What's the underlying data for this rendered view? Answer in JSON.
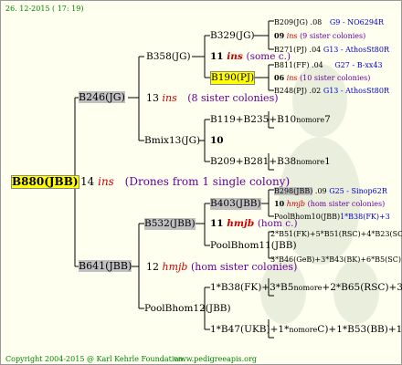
{
  "header": {
    "date": "26. 12-2015 ( 17: 19)"
  },
  "footer": {
    "copyright": "Copyright 2004-2015 @ Karl Kehrle Foundation.",
    "site": "www.pedigreeapis.org"
  },
  "root": {
    "id": "B880(JBB)",
    "gen": "14",
    "tag": "ins",
    "note": "(Drones from 1 single colony)"
  },
  "b246": {
    "id": "B246(JG)",
    "gen": "13",
    "tag": "ins",
    "note": "(8 sister colonies)"
  },
  "b641": {
    "id": "B641(JBB)",
    "gen": "12",
    "tag": "hmjb",
    "note": "(hom sister colonies)"
  },
  "b358": {
    "id": "B358(JG)",
    "gen": "11",
    "tag": "ins",
    "note": "(some c.)"
  },
  "bmix": {
    "id": "Bmix13(JG)",
    "gen": "10"
  },
  "b532": {
    "id": "B532(JBB)",
    "gen": "11",
    "tag": "hmjb",
    "note": "(hom c.)"
  },
  "pool12": {
    "id": "PoolBhom12(JBB)",
    "gen": "10"
  },
  "b329": {
    "id": "B329(JG)",
    "gen": "09",
    "tag": "ins",
    "note": "(some c.)"
  },
  "b190": {
    "id": "B190(PJ)"
  },
  "b119": {
    "id": "B119+B235+B10",
    "suffix": "nomore",
    "gen": "7"
  },
  "b209": {
    "id": "B209+B281+B38",
    "suffix": "nomore",
    "gen": "1"
  },
  "b403": {
    "id": "B403(JBB)",
    "gen": "10",
    "tag": "hmjb",
    "note": "(hom sister colonies)"
  },
  "pool11": {
    "id": "PoolBhom11(JBB)",
    "gen": "09"
  },
  "g5": [
    {
      "id": "B209(JG)",
      "gen": ".08",
      "ref": "G9 - NO6294R"
    },
    {
      "id": "09",
      "tag": "ins",
      "note": "(9 sister colonies)"
    },
    {
      "id": "B271(PJ)",
      "gen": ".04",
      "ref": "G13 - AthosSt80R"
    },
    {
      "id": "B811(FF)",
      "gen": ".04",
      "ref": "G27 - B-xx43"
    },
    {
      "id": "06",
      "tag": "ins",
      "note": "(10 sister colonies)"
    },
    {
      "id": "B248(PJ)",
      "gen": ".02",
      "ref": "G13 - AthosSt80R"
    },
    {
      "id": "B298(JBB)",
      "gen": ".09",
      "ref": "G25 - Sinop62R"
    },
    {
      "id": "10",
      "tag": "hmjb",
      "note": "(hom sister colonies)"
    },
    {
      "id": "PoolBhom10(JBB)",
      "extra": "1*B38(FK)+3"
    },
    {
      "id": "2*B51(FK)+5*B51(RSC)+4*B23(SC)+B8"
    },
    {
      "id": "3*B46(GeB)+3*B43(BK)+6*B5(SC)"
    },
    {
      "id": "1*B38(FK)+3*B5",
      "suffix": "nomore",
      "tail": "+2*B65(RSC)+3*B"
    },
    {
      "id": "1*B47(UKB)+1*",
      "suffix": "nomore",
      "tail": "C)+1*B53(BB)+1*"
    }
  ]
}
